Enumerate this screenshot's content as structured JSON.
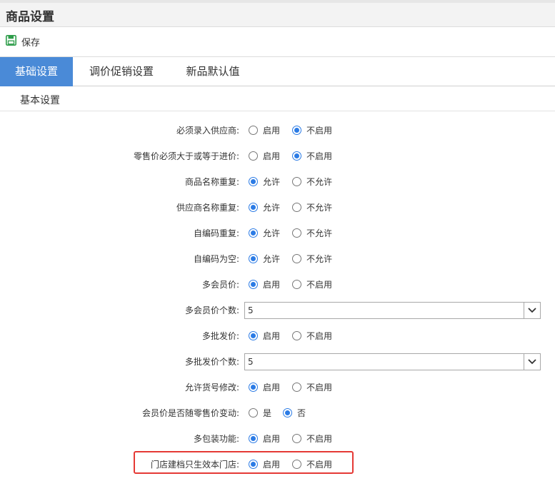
{
  "page": {
    "title": "商品设置"
  },
  "toolbar": {
    "save_label": "保存"
  },
  "tabs": [
    {
      "label": "基础设置",
      "active": true
    },
    {
      "label": "调价促销设置",
      "active": false
    },
    {
      "label": "新品默认值",
      "active": false
    }
  ],
  "section": {
    "label": "基本设置"
  },
  "settings": [
    {
      "label": "必须录入供应商:",
      "options": [
        "启用",
        "不启用"
      ],
      "selected": 1
    },
    {
      "label": "零售价必须大于或等于进价:",
      "options": [
        "启用",
        "不启用"
      ],
      "selected": 1
    },
    {
      "label": "商品名称重复:",
      "options": [
        "允许",
        "不允许"
      ],
      "selected": 0
    },
    {
      "label": "供应商名称重复:",
      "options": [
        "允许",
        "不允许"
      ],
      "selected": 0
    },
    {
      "label": "自编码重复:",
      "options": [
        "允许",
        "不允许"
      ],
      "selected": 0
    },
    {
      "label": "自编码为空:",
      "options": [
        "允许",
        "不允许"
      ],
      "selected": 0
    },
    {
      "label": "多会员价:",
      "options": [
        "启用",
        "不启用"
      ],
      "selected": 0
    },
    {
      "label": "多会员价个数:",
      "select_value": "5"
    },
    {
      "label": "多批发价:",
      "options": [
        "启用",
        "不启用"
      ],
      "selected": 0
    },
    {
      "label": "多批发价个数:",
      "select_value": "5"
    },
    {
      "label": "允许货号修改:",
      "options": [
        "启用",
        "不启用"
      ],
      "selected": 0
    },
    {
      "label": "会员价是否随零售价变动:",
      "options": [
        "是",
        "否"
      ],
      "selected": 1
    },
    {
      "label": "多包装功能:",
      "options": [
        "启用",
        "不启用"
      ],
      "selected": 0
    },
    {
      "label": "门店建档只生效本门店:",
      "options": [
        "启用",
        "不启用"
      ],
      "selected": 0
    }
  ],
  "colors": {
    "accent": "#4a8ad7",
    "radio": "#2b7be5",
    "highlight": "#e53935",
    "save_icon": "#2e9d4a"
  },
  "icons": {
    "save": "floppy-disk-icon",
    "dropdown": "chevron-down-icon"
  }
}
